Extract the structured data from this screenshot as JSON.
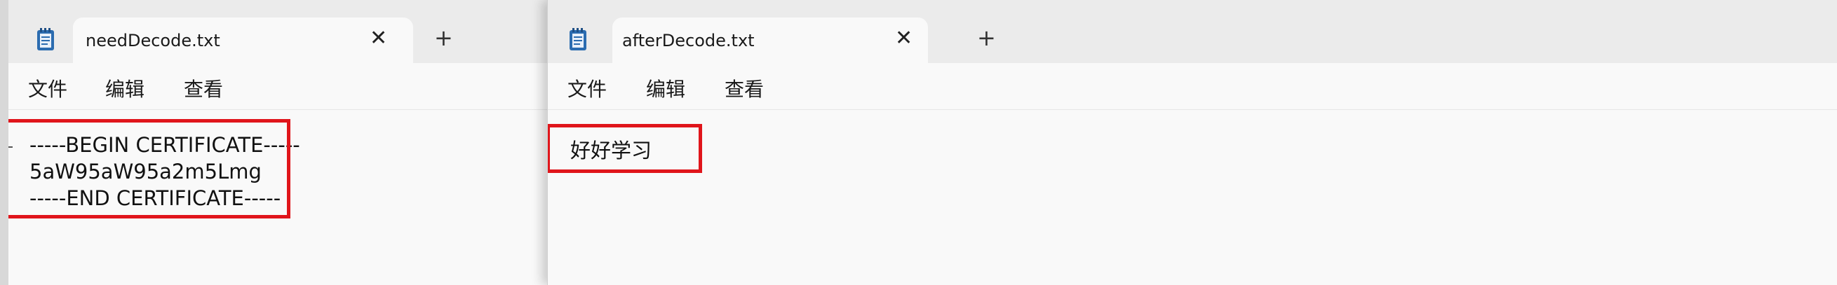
{
  "left_window": {
    "tab_title": "needDecode.txt",
    "close_glyph": "✕",
    "new_tab_glyph": "+",
    "menu": [
      "文件",
      "编辑",
      "查看"
    ],
    "content_lines": [
      "-----BEGIN CERTIFICATE-----",
      "5aW95aW95a2m5Lmg",
      "-----END CERTIFICATE-----"
    ],
    "icon": "notepad-icon"
  },
  "right_window": {
    "tab_title": "afterDecode.txt",
    "close_glyph": "✕",
    "new_tab_glyph": "+",
    "menu": [
      "文件",
      "编辑",
      "查看"
    ],
    "content_lines": [
      "好好学习"
    ],
    "icon": "notepad-icon"
  },
  "colors": {
    "highlight": "#e0151b",
    "notepad_icon": "#2b6cb0"
  }
}
